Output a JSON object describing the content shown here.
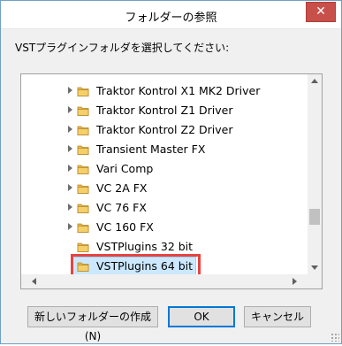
{
  "window": {
    "title": "フォルダーの参照",
    "close_symbol": "✕"
  },
  "prompt": "VSTプラグインフォルダを選択してください:",
  "tree": {
    "items": [
      {
        "label": "Traktor Kontrol X1 MK2 Driver",
        "expandable": true,
        "selected": false
      },
      {
        "label": "Traktor Kontrol Z1 Driver",
        "expandable": true,
        "selected": false
      },
      {
        "label": "Traktor Kontrol Z2 Driver",
        "expandable": true,
        "selected": false
      },
      {
        "label": "Transient Master FX",
        "expandable": true,
        "selected": false
      },
      {
        "label": "Vari Comp",
        "expandable": true,
        "selected": false
      },
      {
        "label": "VC 2A FX",
        "expandable": true,
        "selected": false
      },
      {
        "label": "VC 76 FX",
        "expandable": true,
        "selected": false
      },
      {
        "label": "VC 160 FX",
        "expandable": true,
        "selected": false
      },
      {
        "label": "VSTPlugins 32 bit",
        "expandable": false,
        "selected": false
      },
      {
        "label": "VSTPlugins 64 bit",
        "expandable": false,
        "selected": true
      }
    ]
  },
  "buttons": {
    "new_folder": "新しいフォルダーの作成(N)",
    "ok": "OK",
    "cancel": "キャンセル"
  },
  "colors": {
    "close_button": "#c7504b",
    "selection_fill": "#cce8ff",
    "highlight_border": "#e8433f",
    "folder_yellow": "#e8b84a"
  }
}
